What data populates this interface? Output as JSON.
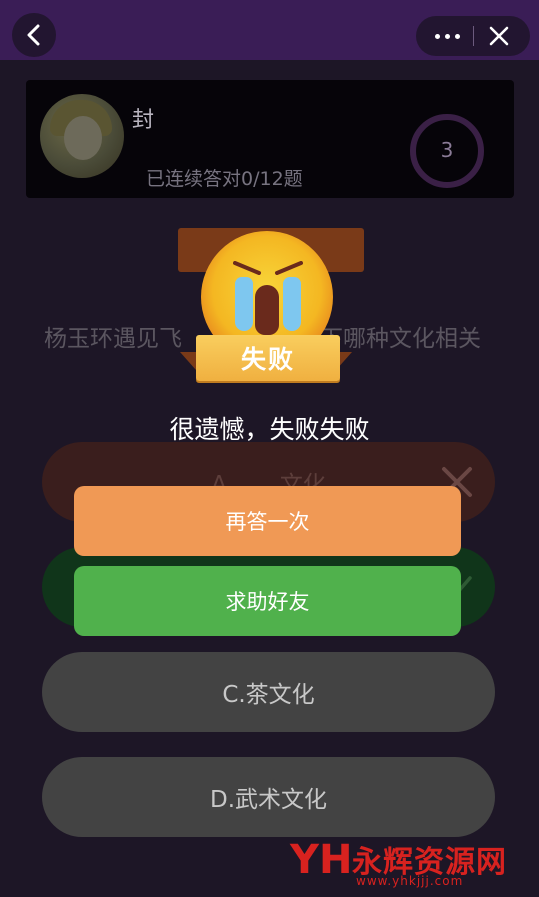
{
  "nav": {
    "back_icon": "chevron-left-icon",
    "more_icon": "more-dots-icon",
    "close_icon": "close-icon"
  },
  "user_card": {
    "username": "封",
    "streak_text": "已连续答对0/12题",
    "score": "3"
  },
  "question": {
    "text": "杨玉环遇见飞　　　　　　下哪种文化相关"
  },
  "options": [
    {
      "label": "A.　　文化",
      "status": "wrong",
      "icon": "cross-icon"
    },
    {
      "label": "",
      "status": "correct",
      "icon": "check-icon"
    },
    {
      "label": "C.茶文化",
      "status": "none"
    },
    {
      "label": "D.武术文化",
      "status": "none"
    }
  ],
  "result": {
    "badge": "失败",
    "emoji_icon": "crying-face-icon",
    "message": "很遗憾，失败失败",
    "retry_label": "再答一次",
    "help_label": "求助好友"
  },
  "watermark": {
    "logo": "YH",
    "title": "永辉资源网",
    "url": "www.yhkjjj.com"
  },
  "colors": {
    "topbar": "#3a1d56",
    "background": "#1d1626",
    "retry_button": "#f09955",
    "help_button": "#50b14c",
    "fail_badge": "#f5bf4f"
  }
}
